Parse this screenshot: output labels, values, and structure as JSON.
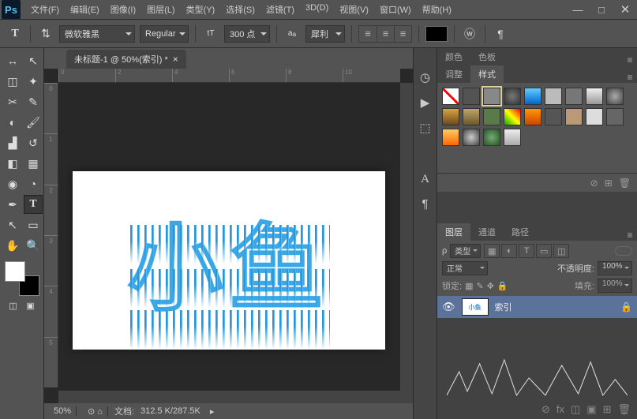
{
  "app": {
    "logo": "Ps"
  },
  "menu": [
    "文件(F)",
    "编辑(E)",
    "图像(I)",
    "图层(L)",
    "类型(Y)",
    "选择(S)",
    "滤镜(T)",
    "3D(D)",
    "视图(V)",
    "窗口(W)",
    "帮助(H)"
  ],
  "options": {
    "font_family": "微软雅黑",
    "font_style": "Regular",
    "font_size": "300 点",
    "aa": "犀利"
  },
  "document": {
    "tab_title": "未标题-1 @ 50%(索引) *",
    "zoom": "50%",
    "doc_info_label": "文档:",
    "doc_info": "312.5 K/287.5K"
  },
  "ruler_h": [
    "0",
    "2",
    "4",
    "6",
    "8",
    "10"
  ],
  "ruler_v": [
    "0",
    "1",
    "2",
    "3",
    "4",
    "5"
  ],
  "canvas": {
    "text_a": "小",
    "text_b": "鱼"
  },
  "panels": {
    "color_tab": "颜色",
    "swatch_tab": "色板",
    "adjust_tab": "调整",
    "styles_tab": "样式",
    "layers_tab": "图层",
    "channels_tab": "通道",
    "paths_tab": "路径"
  },
  "styles": [
    "none",
    "#000:linear-gradient(#f7a,#f00,#fa0)",
    "#888",
    "radial-gradient(#777,#333)",
    "linear-gradient(#6cf,#06c)",
    "#bbb",
    "#777",
    "linear-gradient(#eee,#999)",
    "radial-gradient(#aaa,#444)",
    "linear-gradient(#d9a441,#6b4a1a)",
    "linear-gradient(#bfa36b,#6b5a2a)",
    "#5a7a4a",
    "linear-gradient(45deg,#0a0,#ff0,#f00)",
    "linear-gradient(#f90,#c40)",
    "#555",
    "#b97",
    "#ddd",
    "#666",
    "linear-gradient(#fc6,#f60)",
    "radial-gradient(#ccc,#444)",
    "radial-gradient(#7a7,#252)",
    "linear-gradient(#eee,#aaa)"
  ],
  "layers": {
    "filter_label": "类型",
    "blend_mode": "正常",
    "opacity_label": "不透明度:",
    "opacity": "100%",
    "lock_label": "锁定:",
    "fill_label": "填充:",
    "fill": "100%",
    "layer_name": "索引",
    "thumb_text": "小鱼",
    "kind_label": "ρ"
  }
}
